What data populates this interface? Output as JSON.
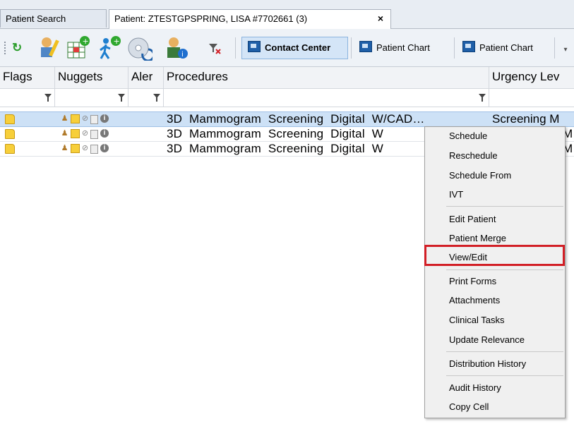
{
  "tabs": [
    {
      "label": "Patient Search"
    },
    {
      "label": "Patient: ZTESTGPSPRING, LISA #7702661 (3)",
      "close": "×"
    }
  ],
  "toolbar": {
    "icons": [
      "refresh-icon",
      "edit-document-icon",
      "add-grid-icon",
      "walk-in-icon",
      "disc-icon",
      "user-info-icon",
      "clear-filter-icon"
    ],
    "contact_center": "Contact Center",
    "patient_chart_1": "Patient Chart",
    "patient_chart_2": "Patient Chart"
  },
  "grid": {
    "headers": [
      "Flags",
      "Nuggets",
      "Aler",
      "Procedures",
      "Urgency Lev"
    ],
    "rows": [
      {
        "procedure": "3D Mammogram Screening Digital W/CAD…",
        "urgency": "Screening M",
        "selected": true
      },
      {
        "procedure": "3D Mammogram Screening Digital W",
        "urgency": "M",
        "selected": false
      },
      {
        "procedure": "3D Mammogram Screening Digital W",
        "urgency": "M",
        "selected": false
      }
    ]
  },
  "context_menu": {
    "items": [
      [
        "Schedule",
        "Reschedule",
        "Schedule From",
        "IVT"
      ],
      [
        "Edit Patient",
        "Patient Merge",
        "View/Edit"
      ],
      [
        "Print Forms",
        "Attachments",
        "Clinical Tasks",
        "Update Relevance"
      ],
      [
        "Distribution History"
      ],
      [
        "Audit History",
        "Copy Cell"
      ]
    ],
    "highlighted": "View/Edit"
  },
  "colors": {
    "highlight_border": "#d21f26",
    "selected_row": "#cde1f6",
    "flag": "#f7cf3a"
  }
}
